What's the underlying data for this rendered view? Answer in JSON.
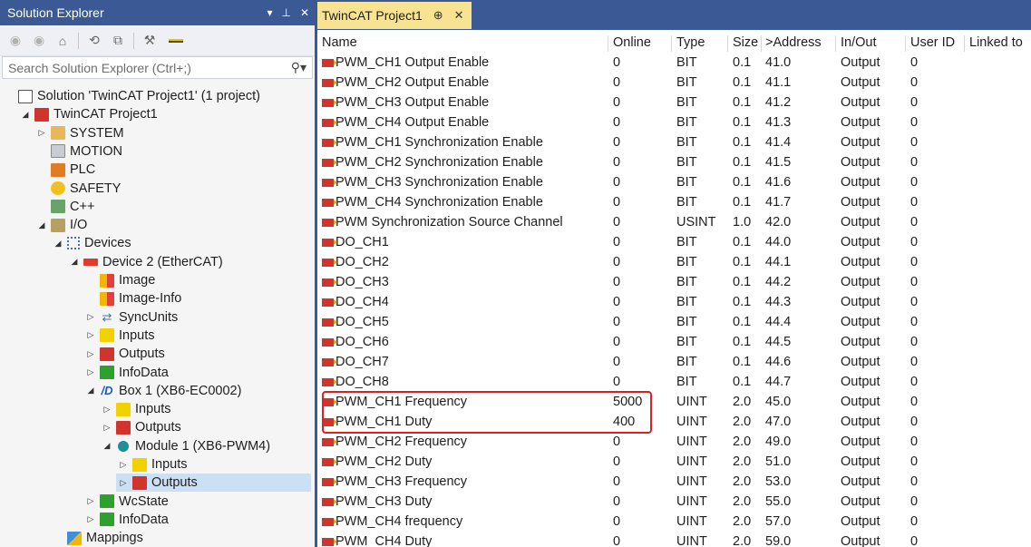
{
  "solution_explorer": {
    "title": "Solution Explorer",
    "title_controls": [
      "▾",
      "⊥",
      "✕"
    ],
    "search_placeholder": "Search Solution Explorer (Ctrl+;)",
    "tree": [
      {
        "label": "Solution 'TwinCAT Project1' (1 project)",
        "icon": "solution-icon",
        "depth": 0,
        "expander": ""
      },
      {
        "label": "TwinCAT Project1",
        "icon": "project-icon",
        "depth": 1,
        "expander": "◢"
      },
      {
        "label": "SYSTEM",
        "icon": "system-icon",
        "depth": 2,
        "expander": "▷"
      },
      {
        "label": "MOTION",
        "icon": "motion-icon",
        "depth": 2,
        "expander": ""
      },
      {
        "label": "PLC",
        "icon": "plc-icon",
        "depth": 2,
        "expander": ""
      },
      {
        "label": "SAFETY",
        "icon": "safety-icon",
        "depth": 2,
        "expander": ""
      },
      {
        "label": "C++",
        "icon": "cpp-icon",
        "depth": 2,
        "expander": ""
      },
      {
        "label": "I/O",
        "icon": "io-icon",
        "depth": 2,
        "expander": "◢"
      },
      {
        "label": "Devices",
        "icon": "devices-icon",
        "depth": 3,
        "expander": "◢"
      },
      {
        "label": "Device 2 (EtherCAT)",
        "icon": "ethercat-icon",
        "depth": 4,
        "expander": "◢"
      },
      {
        "label": "Image",
        "icon": "image-icon",
        "depth": 5,
        "expander": ""
      },
      {
        "label": "Image-Info",
        "icon": "image-info-icon",
        "depth": 5,
        "expander": ""
      },
      {
        "label": "SyncUnits",
        "icon": "syncunits-icon",
        "depth": 5,
        "expander": "▷"
      },
      {
        "label": "Inputs",
        "icon": "inputs-icon",
        "depth": 5,
        "expander": "▷"
      },
      {
        "label": "Outputs",
        "icon": "outputs-icon",
        "depth": 5,
        "expander": "▷"
      },
      {
        "label": "InfoData",
        "icon": "infodata-icon",
        "depth": 5,
        "expander": "▷"
      },
      {
        "label": "Box 1 (XB6-EC0002)",
        "icon": "box-icon",
        "depth": 5,
        "expander": "◢"
      },
      {
        "label": "Inputs",
        "icon": "inputs-icon",
        "depth": 6,
        "expander": "▷"
      },
      {
        "label": "Outputs",
        "icon": "outputs-icon",
        "depth": 6,
        "expander": "▷"
      },
      {
        "label": "Module 1 (XB6-PWM4)",
        "icon": "module-icon",
        "depth": 6,
        "expander": "◢"
      },
      {
        "label": "Inputs",
        "icon": "inputs-icon",
        "depth": 7,
        "expander": "▷"
      },
      {
        "label": "Outputs",
        "icon": "outputs-icon",
        "depth": 7,
        "expander": "▷",
        "selected": true
      },
      {
        "label": "WcState",
        "icon": "wcstate-icon",
        "depth": 5,
        "expander": "▷"
      },
      {
        "label": "InfoData",
        "icon": "infodata-icon",
        "depth": 5,
        "expander": "▷"
      },
      {
        "label": "Mappings",
        "icon": "mappings-icon",
        "depth": 3,
        "expander": ""
      }
    ]
  },
  "tab": {
    "title": "TwinCAT Project1",
    "pin": "⊕",
    "close": "✕"
  },
  "table": {
    "columns": [
      "Name",
      "Online",
      "Type",
      "Size",
      ">Address",
      "In/Out",
      "User ID",
      "Linked to"
    ],
    "rows": [
      [
        "PWM_CH1 Output Enable",
        "0",
        "BIT",
        "0.1",
        "41.0",
        "Output",
        "0"
      ],
      [
        "PWM_CH2 Output Enable",
        "0",
        "BIT",
        "0.1",
        "41.1",
        "Output",
        "0"
      ],
      [
        "PWM_CH3 Output Enable",
        "0",
        "BIT",
        "0.1",
        "41.2",
        "Output",
        "0"
      ],
      [
        "PWM_CH4 Output Enable",
        "0",
        "BIT",
        "0.1",
        "41.3",
        "Output",
        "0"
      ],
      [
        "PWM_CH1 Synchronization Enable",
        "0",
        "BIT",
        "0.1",
        "41.4",
        "Output",
        "0"
      ],
      [
        "PWM_CH2 Synchronization Enable",
        "0",
        "BIT",
        "0.1",
        "41.5",
        "Output",
        "0"
      ],
      [
        "PWM_CH3 Synchronization Enable",
        "0",
        "BIT",
        "0.1",
        "41.6",
        "Output",
        "0"
      ],
      [
        "PWM_CH4 Synchronization Enable",
        "0",
        "BIT",
        "0.1",
        "41.7",
        "Output",
        "0"
      ],
      [
        "PWM Synchronization Source Channel",
        "0",
        "USINT",
        "1.0",
        "42.0",
        "Output",
        "0"
      ],
      [
        "DO_CH1",
        "0",
        "BIT",
        "0.1",
        "44.0",
        "Output",
        "0"
      ],
      [
        "DO_CH2",
        "0",
        "BIT",
        "0.1",
        "44.1",
        "Output",
        "0"
      ],
      [
        "DO_CH3",
        "0",
        "BIT",
        "0.1",
        "44.2",
        "Output",
        "0"
      ],
      [
        "DO_CH4",
        "0",
        "BIT",
        "0.1",
        "44.3",
        "Output",
        "0"
      ],
      [
        "DO_CH5",
        "0",
        "BIT",
        "0.1",
        "44.4",
        "Output",
        "0"
      ],
      [
        "DO_CH6",
        "0",
        "BIT",
        "0.1",
        "44.5",
        "Output",
        "0"
      ],
      [
        "DO_CH7",
        "0",
        "BIT",
        "0.1",
        "44.6",
        "Output",
        "0"
      ],
      [
        "DO_CH8",
        "0",
        "BIT",
        "0.1",
        "44.7",
        "Output",
        "0"
      ],
      [
        "PWM_CH1 Frequency",
        "5000",
        "UINT",
        "2.0",
        "45.0",
        "Output",
        "0"
      ],
      [
        "PWM_CH1 Duty",
        "400",
        "UINT",
        "2.0",
        "47.0",
        "Output",
        "0"
      ],
      [
        "PWM_CH2 Frequency",
        "0",
        "UINT",
        "2.0",
        "49.0",
        "Output",
        "0"
      ],
      [
        "PWM_CH2 Duty",
        "0",
        "UINT",
        "2.0",
        "51.0",
        "Output",
        "0"
      ],
      [
        "PWM_CH3 Frequency",
        "0",
        "UINT",
        "2.0",
        "53.0",
        "Output",
        "0"
      ],
      [
        "PWM_CH3 Duty",
        "0",
        "UINT",
        "2.0",
        "55.0",
        "Output",
        "0"
      ],
      [
        "PWM_CH4 frequency",
        "0",
        "UINT",
        "2.0",
        "57.0",
        "Output",
        "0"
      ],
      [
        "PWM_CH4 Duty",
        "0",
        "UINT",
        "2.0",
        "59.0",
        "Output",
        "0"
      ]
    ],
    "highlighted_rows": [
      "PWM_CH1 Frequency",
      "PWM_CH1 Duty"
    ],
    "highlight_color": "#e02020"
  },
  "colors": {
    "accent": "#3b5a95",
    "tab_active": "#f7e391",
    "selection": "#cce0f5"
  }
}
